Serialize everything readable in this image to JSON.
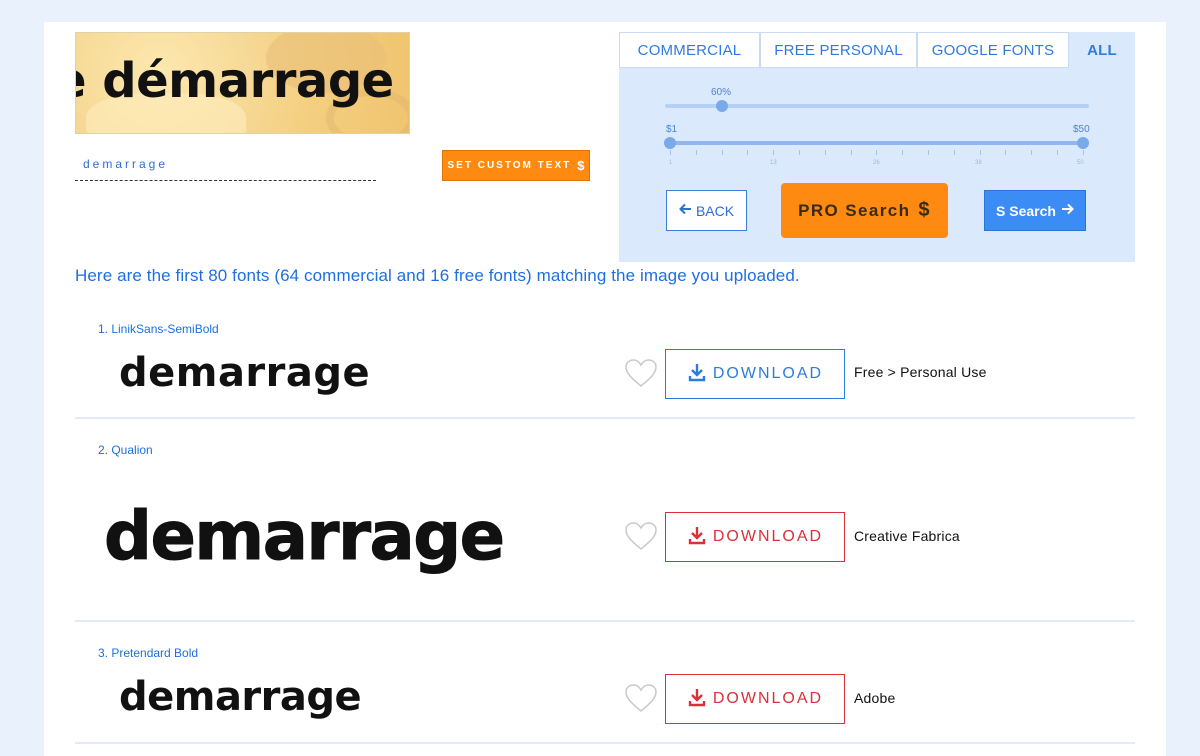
{
  "preview": {
    "text": "e démarrage c"
  },
  "custom_text": {
    "value": "demarrage"
  },
  "set_custom_button": {
    "label": "SET CUSTOM TEXT",
    "icon": "dollar-icon"
  },
  "tabs": [
    {
      "label": "COMMERCIAL",
      "active": false
    },
    {
      "label": "FREE PERSONAL",
      "active": false
    },
    {
      "label": "GOOGLE FONTS",
      "active": false
    },
    {
      "label": "ALL",
      "active": true
    }
  ],
  "similarity_slider": {
    "value_label": "60%",
    "value": 0.6
  },
  "price_slider": {
    "min_label": "$1",
    "max_label": "$50",
    "ticks": [
      "1",
      "13",
      "26",
      "38",
      "50"
    ]
  },
  "buttons": {
    "back": "BACK",
    "pro_search": "PRO Search",
    "s_search": "S Search"
  },
  "summary": "Here are the first 80 fonts (64 commercial and 16 free fonts) matching the image you uploaded.",
  "results": [
    {
      "name": "1. LinikSans-SemiBold",
      "sample": "demarrage",
      "download": "DOWNLOAD",
      "source": "Free > Personal Use",
      "color": "#2e7be0"
    },
    {
      "name": "2. Qualion",
      "sample": "demarrage",
      "download": "DOWNLOAD",
      "source": "Creative Fabrica",
      "color": "#d9303a"
    },
    {
      "name": "3. Pretendard Bold",
      "sample": "demarrage",
      "download": "DOWNLOAD",
      "source": "Adobe",
      "color": "#d9303a"
    }
  ]
}
